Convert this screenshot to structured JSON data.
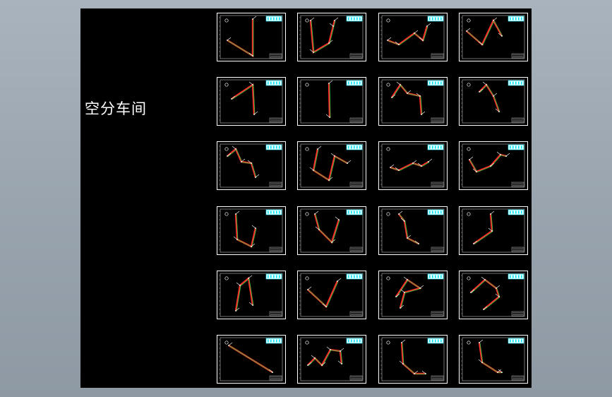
{
  "viewer": {
    "title": "空分车间",
    "colors": {
      "background": "#000000",
      "frame": "#ffffff",
      "pipe_main": "#ff2a2a",
      "pipe_center": "#2ecc40",
      "title_block": "#00e5ff"
    }
  },
  "sheets": [
    {
      "row": 0,
      "col": 0,
      "path": [
        [
          14,
          38
        ],
        [
          50,
          60
        ],
        [
          50,
          8
        ]
      ]
    },
    {
      "row": 0,
      "col": 1,
      "path": [
        [
          18,
          10
        ],
        [
          22,
          55
        ],
        [
          44,
          42
        ],
        [
          50,
          18
        ],
        [
          52,
          10
        ]
      ]
    },
    {
      "row": 0,
      "col": 2,
      "path": [
        [
          12,
          38
        ],
        [
          28,
          44
        ],
        [
          50,
          28
        ],
        [
          62,
          38
        ],
        [
          68,
          18
        ]
      ]
    },
    {
      "row": 0,
      "col": 3,
      "path": [
        [
          10,
          25
        ],
        [
          32,
          44
        ],
        [
          48,
          10
        ],
        [
          60,
          32
        ]
      ]
    },
    {
      "row": 1,
      "col": 0,
      "path": [
        [
          20,
          30
        ],
        [
          50,
          10
        ],
        [
          52,
          52
        ]
      ]
    },
    {
      "row": 1,
      "col": 1,
      "path": [
        [
          44,
          8
        ],
        [
          45,
          56
        ]
      ]
    },
    {
      "row": 1,
      "col": 2,
      "path": [
        [
          18,
          28
        ],
        [
          30,
          10
        ],
        [
          40,
          22
        ],
        [
          58,
          26
        ],
        [
          60,
          52
        ]
      ]
    },
    {
      "row": 1,
      "col": 3,
      "path": [
        [
          28,
          20
        ],
        [
          38,
          10
        ],
        [
          48,
          26
        ],
        [
          56,
          48
        ]
      ]
    },
    {
      "row": 2,
      "col": 0,
      "path": [
        [
          14,
          20
        ],
        [
          26,
          10
        ],
        [
          34,
          28
        ],
        [
          48,
          30
        ],
        [
          54,
          50
        ]
      ]
    },
    {
      "row": 2,
      "col": 1,
      "path": [
        [
          28,
          10
        ],
        [
          22,
          40
        ],
        [
          44,
          54
        ],
        [
          52,
          20
        ],
        [
          70,
          30
        ]
      ]
    },
    {
      "row": 2,
      "col": 2,
      "path": [
        [
          16,
          36
        ],
        [
          28,
          40
        ],
        [
          48,
          30
        ],
        [
          60,
          34
        ],
        [
          70,
          28
        ]
      ]
    },
    {
      "row": 2,
      "col": 3,
      "path": [
        [
          14,
          25
        ],
        [
          24,
          42
        ],
        [
          44,
          34
        ],
        [
          58,
          18
        ],
        [
          66,
          20
        ]
      ]
    },
    {
      "row": 3,
      "col": 0,
      "path": [
        [
          26,
          10
        ],
        [
          28,
          46
        ],
        [
          48,
          56
        ],
        [
          54,
          30
        ]
      ]
    },
    {
      "row": 3,
      "col": 1,
      "path": [
        [
          24,
          10
        ],
        [
          30,
          32
        ],
        [
          48,
          50
        ],
        [
          58,
          18
        ]
      ]
    },
    {
      "row": 3,
      "col": 2,
      "path": [
        [
          28,
          10
        ],
        [
          36,
          20
        ],
        [
          40,
          44
        ],
        [
          56,
          52
        ]
      ]
    },
    {
      "row": 3,
      "col": 3,
      "path": [
        [
          44,
          10
        ],
        [
          46,
          34
        ],
        [
          20,
          52
        ]
      ]
    },
    {
      "row": 4,
      "col": 0,
      "path": [
        [
          26,
          56
        ],
        [
          32,
          20
        ],
        [
          44,
          10
        ],
        [
          50,
          48
        ]
      ]
    },
    {
      "row": 4,
      "col": 1,
      "path": [
        [
          14,
          26
        ],
        [
          40,
          50
        ],
        [
          56,
          14
        ]
      ]
    },
    {
      "row": 4,
      "col": 2,
      "path": [
        [
          24,
          36
        ],
        [
          40,
          12
        ],
        [
          58,
          24
        ],
        [
          36,
          30
        ],
        [
          30,
          52
        ]
      ]
    },
    {
      "row": 4,
      "col": 3,
      "path": [
        [
          16,
          30
        ],
        [
          36,
          12
        ],
        [
          52,
          24
        ],
        [
          56,
          36
        ],
        [
          34,
          54
        ]
      ]
    },
    {
      "row": 5,
      "col": 0,
      "path": [
        [
          16,
          14
        ],
        [
          78,
          52
        ]
      ]
    },
    {
      "row": 5,
      "col": 1,
      "path": [
        [
          14,
          42
        ],
        [
          24,
          32
        ],
        [
          34,
          42
        ],
        [
          46,
          20
        ],
        [
          60,
          22
        ],
        [
          62,
          40
        ]
      ]
    },
    {
      "row": 5,
      "col": 2,
      "path": [
        [
          32,
          10
        ],
        [
          34,
          40
        ],
        [
          50,
          54
        ],
        [
          66,
          54
        ]
      ]
    },
    {
      "row": 5,
      "col": 3,
      "path": [
        [
          28,
          10
        ],
        [
          32,
          38
        ],
        [
          54,
          52
        ],
        [
          60,
          52
        ]
      ]
    }
  ]
}
